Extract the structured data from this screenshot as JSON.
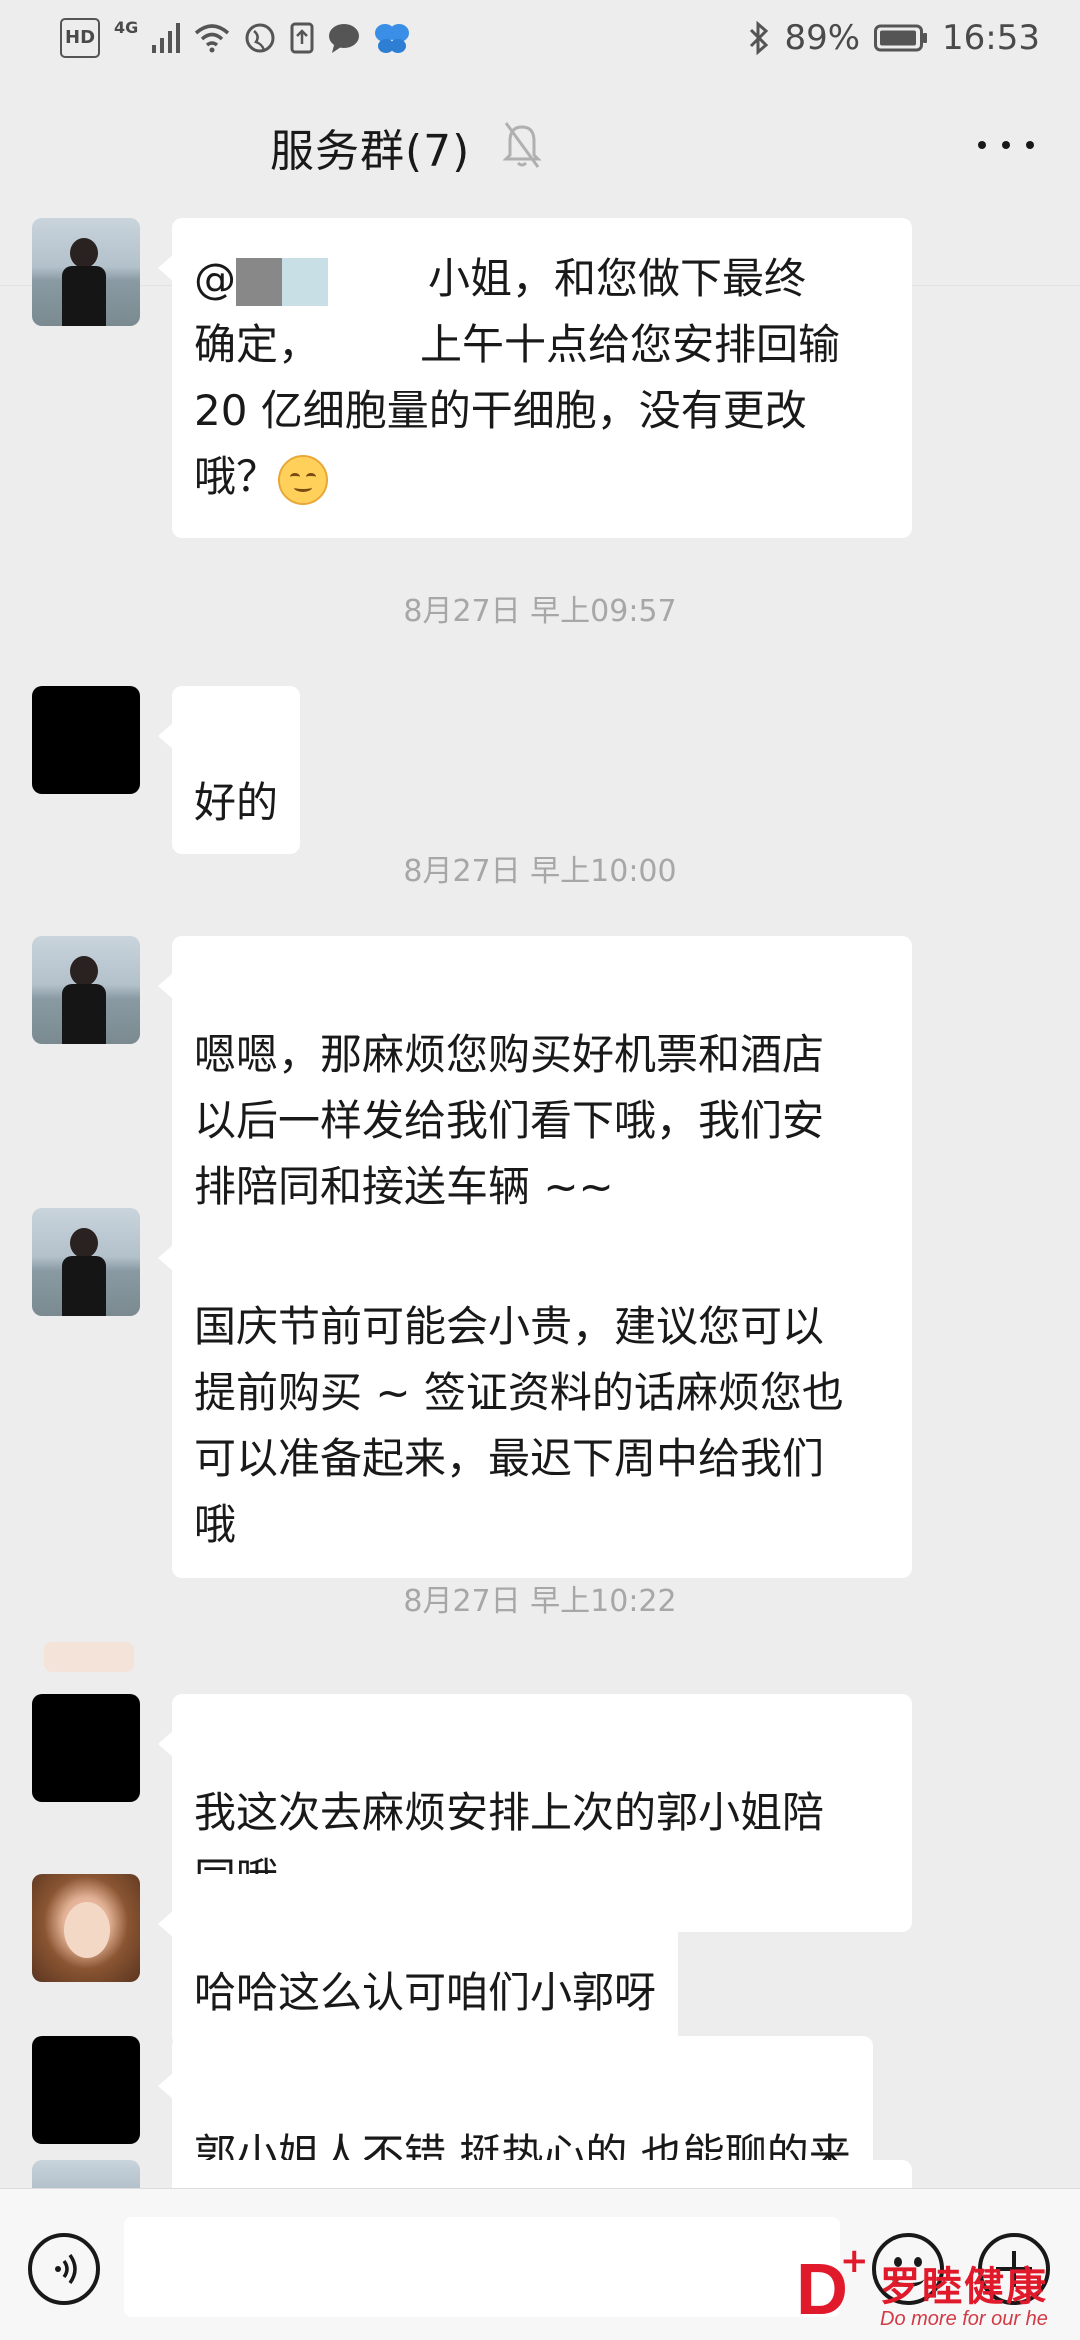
{
  "status_bar": {
    "hd": "HD",
    "network": "4G",
    "battery": "89%",
    "time": "16:53"
  },
  "header": {
    "title": "服务群(7)"
  },
  "messages": [
    {
      "sender": "agent",
      "prefix": "@",
      "line1_rest": "小姐，和您做下最终",
      "line2_a": "确定，",
      "line2_b": "上午十点给您安排回输",
      "line3": "20 亿细胞量的干细胞，没有更改",
      "line4": "哦？"
    },
    {
      "sender": "user",
      "text": "好的"
    },
    {
      "sender": "agent",
      "text": "嗯嗯，那麻烦您购买好机票和酒店\n以后一样发给我们看下哦，我们安\n排陪同和接送车辆 ~~"
    },
    {
      "sender": "agent",
      "text": "国庆节前可能会小贵，建议您可以\n提前购买 ~ 签证资料的话麻烦您也\n可以准备起来，最迟下周中给我们\n哦"
    },
    {
      "sender": "user",
      "text": "我这次去麻烦安排上次的郭小姐陪\n同哦"
    },
    {
      "sender": "staff",
      "text": "哈哈这么认可咱们小郭呀"
    },
    {
      "sender": "user",
      "text": "郭小姐人不错 挺热心的 也能聊的来"
    }
  ],
  "timestamps": [
    "8月27日 早上09:57",
    "8月27日 早上10:00",
    "8月27日 早上10:22"
  ],
  "input": {
    "placeholder": ""
  },
  "watermark": {
    "brand": "罗睦健康",
    "slogan": "Do more for our he"
  },
  "icons": {
    "status": [
      "hd-icon",
      "network-4g-icon",
      "signal-icon",
      "wifi-icon",
      "globe-icon",
      "upload-icon",
      "chat-bubble-icon",
      "butterfly-icon",
      "bluetooth-icon",
      "battery-icon"
    ],
    "header": [
      "mute-bell-icon",
      "more-icon"
    ],
    "input_bar": [
      "voice-icon",
      "emoji-icon",
      "plus-icon"
    ]
  }
}
